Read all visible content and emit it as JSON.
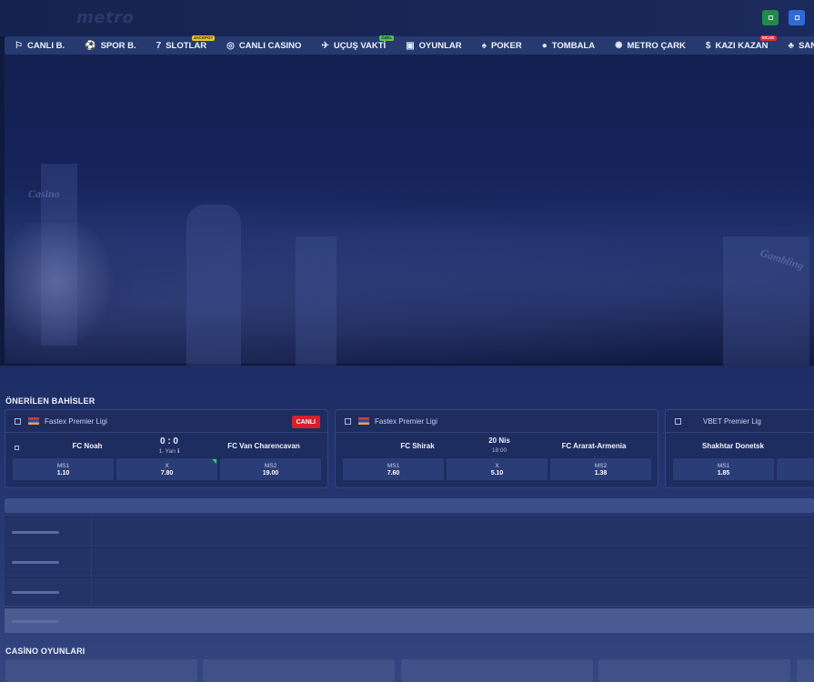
{
  "header": {
    "logo_text": "metro"
  },
  "nav": {
    "items": [
      {
        "label": "CANLI B.",
        "icon": "live-icon",
        "glyph": "⚐"
      },
      {
        "label": "SPOR B.",
        "icon": "soccer-ball-icon",
        "glyph": "⚽"
      },
      {
        "label": "SLOTLAR",
        "icon": "seven-icon",
        "glyph": "7",
        "badge": "JACKPOT"
      },
      {
        "label": "CANLI CASINO",
        "icon": "chip-icon",
        "glyph": "◎"
      },
      {
        "label": "UÇUŞ VAKTİ",
        "icon": "plane-icon",
        "glyph": "✈",
        "badge": "ÖZEL"
      },
      {
        "label": "OYUNLAR",
        "icon": "games-icon",
        "glyph": "▣"
      },
      {
        "label": "POKER",
        "icon": "spade-icon",
        "glyph": "♠"
      },
      {
        "label": "TOMBALA",
        "icon": "tombala-icon",
        "glyph": "●"
      },
      {
        "label": "METRO ÇARK",
        "icon": "wheel-icon",
        "glyph": "✺"
      },
      {
        "label": "KAZI KAZAN",
        "icon": "scratch-icon",
        "glyph": "$",
        "badge": "SICAK"
      },
      {
        "label": "SANAL B.",
        "icon": "virtual-icon",
        "glyph": "♣"
      }
    ]
  },
  "hero": {
    "sign_left": "Casino",
    "sign_right": "Gambling"
  },
  "recommended": {
    "title": "ÖNERİLEN BAHİSLER",
    "cards": [
      {
        "league": "Fastex Premier Ligi",
        "live_label": "CANLI",
        "home": "FC Noah",
        "away": "FC Van Charencavan",
        "center_main": "0 : 0",
        "center_sub": "1. Yarı",
        "odds": [
          {
            "label": "MS1",
            "value": "1.10"
          },
          {
            "label": "X",
            "value": "7.80"
          },
          {
            "label": "MS2",
            "value": "19.00"
          }
        ]
      },
      {
        "league": "Fastex Premier Ligi",
        "home": "FC Shirak",
        "away": "FC Ararat-Armenia",
        "center_main": "20 Nis",
        "center_sub": "18:00",
        "odds": [
          {
            "label": "MS1",
            "value": "7.60"
          },
          {
            "label": "X",
            "value": "5.10"
          },
          {
            "label": "MS2",
            "value": "1.38"
          }
        ]
      },
      {
        "league": "VBET Premier Lig",
        "home": "Shakhtar Donetsk",
        "odds": [
          {
            "label": "MS1",
            "value": "1.85"
          }
        ]
      }
    ]
  },
  "casino": {
    "title": "CASİNO OYUNLARI"
  }
}
